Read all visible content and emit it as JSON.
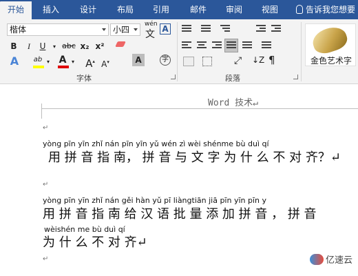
{
  "tabs": [
    "开始",
    "插入",
    "设计",
    "布局",
    "引用",
    "邮件",
    "审阅",
    "视图"
  ],
  "tell_me": "告诉我您想要",
  "font": {
    "name": "楷体",
    "size": "小四",
    "pinyin_guide": "wén",
    "group_label": "字体",
    "bold": "B",
    "italic": "I",
    "underline": "U",
    "strike": "abc",
    "subscript": "x₂",
    "superscript": "x²",
    "text_effects": "A",
    "highlight": "ab",
    "font_color": "A",
    "grow": "A",
    "shrink": "A",
    "char_shading": "A",
    "enclosed": "字",
    "char_border": "A"
  },
  "paragraph": {
    "group_label": "段落"
  },
  "styles": {
    "wordart_label": "金色艺术字"
  },
  "document": {
    "header": "Word 技术↵",
    "line1_pinyin": "yòng pīn yīn zhǐ nán   pīn yīn yǔ wén zì wèi shénme bù duì qí",
    "line1_text": "用 拼 音 指 南， 拼 音 与 文 字 为 什 么 不 对 齐？↵",
    "line2_pinyin": "yòng pīn yīn zhǐ nán gěi hàn yǔ  pī liàngtiān jiā pīn yīn        pīn y",
    "line2_text": "用 拼 音 指 南 给 汉 语 批 量  添  加 拼 音 ，   拼 音",
    "line3_pinyin": "wèishén me  bù  duì  qí",
    "line3_text": "为 什 么 不 对 齐↵",
    "para_mark": "↵"
  },
  "watermark": "亿速云"
}
